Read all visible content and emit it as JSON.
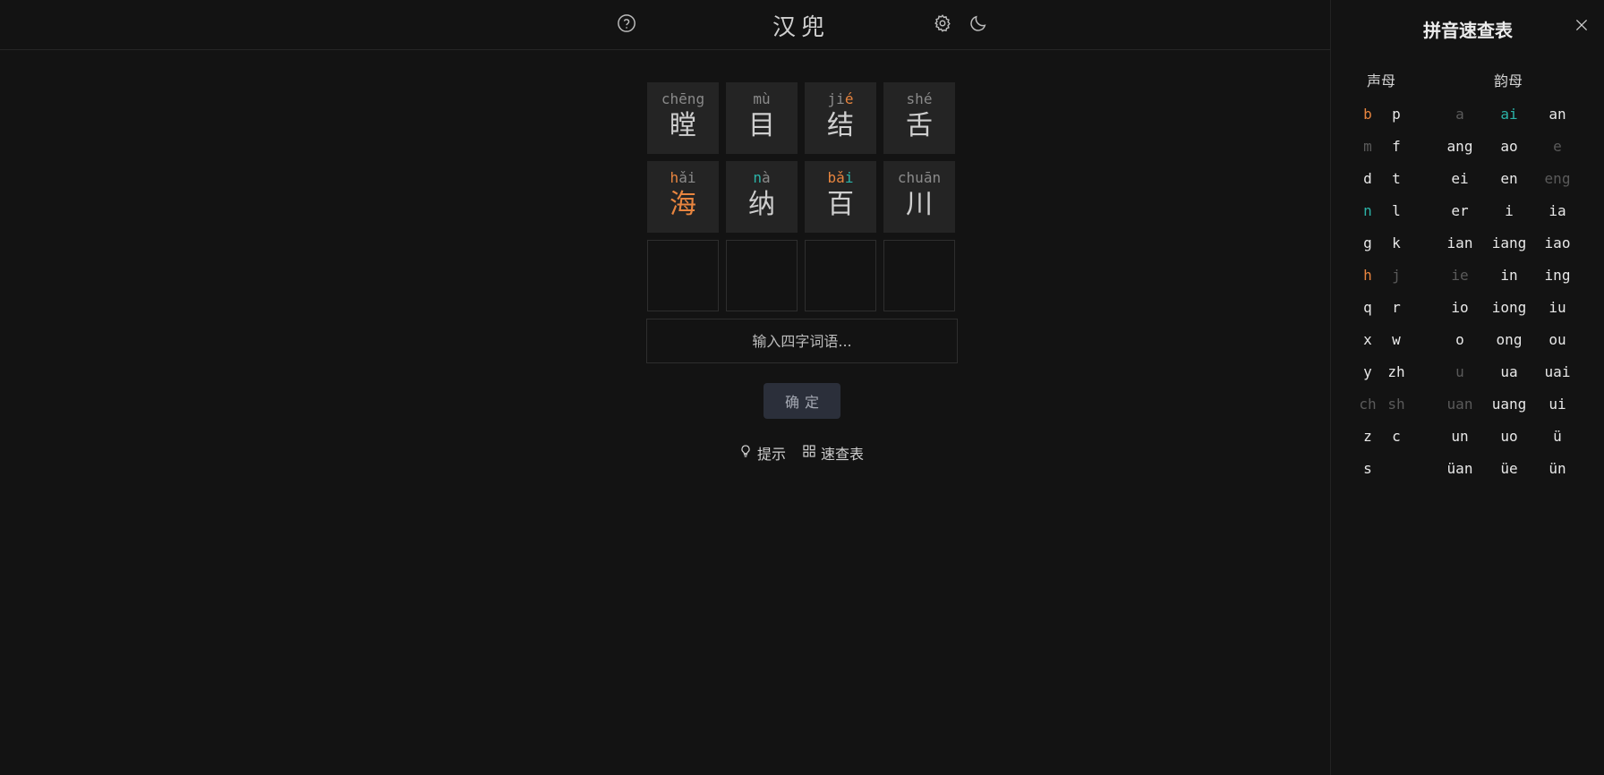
{
  "app": {
    "title": "汉兜"
  },
  "header": {
    "help_icon": "question-circle-icon",
    "settings_icon": "gear-icon",
    "theme_icon": "moon-icon"
  },
  "board": {
    "rows": [
      [
        {
          "pinyin": [
            {
              "t": "ch",
              "s": "dim"
            },
            {
              "t": "ēng",
              "s": "dim"
            }
          ],
          "hanzi": "瞠",
          "hanzi_state": "default"
        },
        {
          "pinyin": [
            {
              "t": "m",
              "s": "dim"
            },
            {
              "t": "ù",
              "s": "dim"
            }
          ],
          "hanzi": "目",
          "hanzi_state": "default"
        },
        {
          "pinyin": [
            {
              "t": "j",
              "s": "dim"
            },
            {
              "t": "i",
              "s": "dim"
            },
            {
              "t": "é",
              "s": "orange"
            }
          ],
          "hanzi": "结",
          "hanzi_state": "default"
        },
        {
          "pinyin": [
            {
              "t": "sh",
              "s": "dim"
            },
            {
              "t": "é",
              "s": "dim"
            }
          ],
          "hanzi": "舌",
          "hanzi_state": "default"
        }
      ],
      [
        {
          "pinyin": [
            {
              "t": "h",
              "s": "orange"
            },
            {
              "t": "ǎi",
              "s": "dim"
            }
          ],
          "hanzi": "海",
          "hanzi_state": "orange"
        },
        {
          "pinyin": [
            {
              "t": "n",
              "s": "teal"
            },
            {
              "t": "à",
              "s": "dim"
            }
          ],
          "hanzi": "纳",
          "hanzi_state": "default"
        },
        {
          "pinyin": [
            {
              "t": "b",
              "s": "orange"
            },
            {
              "t": "ǎ",
              "s": "orange"
            },
            {
              "t": "i",
              "s": "teal"
            }
          ],
          "hanzi": "百",
          "hanzi_state": "default"
        },
        {
          "pinyin": [
            {
              "t": "ch",
              "s": "dim"
            },
            {
              "t": "u",
              "s": "dim"
            },
            {
              "t": "ān",
              "s": "dim"
            }
          ],
          "hanzi": "川",
          "hanzi_state": "default"
        }
      ],
      [
        {
          "pinyin": [],
          "hanzi": "",
          "hanzi_state": "empty"
        },
        {
          "pinyin": [],
          "hanzi": "",
          "hanzi_state": "empty"
        },
        {
          "pinyin": [],
          "hanzi": "",
          "hanzi_state": "empty"
        },
        {
          "pinyin": [],
          "hanzi": "",
          "hanzi_state": "empty"
        }
      ]
    ]
  },
  "input": {
    "placeholder": "输入四字词语...",
    "value": ""
  },
  "confirm": {
    "label": "确定"
  },
  "actions": {
    "hint_label": "提示",
    "hint_icon": "lightbulb-icon",
    "table_label": "速查表",
    "table_icon": "grid-icon"
  },
  "sidebar": {
    "title": "拼音速查表",
    "close_icon": "close-icon",
    "initials_header": "声母",
    "finals_header": "韵母",
    "initials": [
      [
        {
          "t": "b",
          "s": "orange"
        },
        {
          "t": "p",
          "s": "normal"
        }
      ],
      [
        {
          "t": "m",
          "s": "absent"
        },
        {
          "t": "f",
          "s": "normal"
        }
      ],
      [
        {
          "t": "d",
          "s": "normal"
        },
        {
          "t": "t",
          "s": "normal"
        }
      ],
      [
        {
          "t": "n",
          "s": "teal"
        },
        {
          "t": "l",
          "s": "normal"
        }
      ],
      [
        {
          "t": "g",
          "s": "normal"
        },
        {
          "t": "k",
          "s": "normal"
        }
      ],
      [
        {
          "t": "h",
          "s": "orange"
        },
        {
          "t": "j",
          "s": "absent"
        }
      ],
      [
        {
          "t": "q",
          "s": "normal"
        },
        {
          "t": "r",
          "s": "normal"
        }
      ],
      [
        {
          "t": "x",
          "s": "normal"
        },
        {
          "t": "w",
          "s": "normal"
        }
      ],
      [
        {
          "t": "y",
          "s": "normal"
        },
        {
          "t": "zh",
          "s": "normal"
        }
      ],
      [
        {
          "t": "ch",
          "s": "absent"
        },
        {
          "t": "sh",
          "s": "absent"
        }
      ],
      [
        {
          "t": "z",
          "s": "normal"
        },
        {
          "t": "c",
          "s": "normal"
        }
      ],
      [
        {
          "t": "s",
          "s": "normal"
        }
      ]
    ],
    "finals": [
      [
        {
          "t": "a",
          "s": "absent"
        },
        {
          "t": "ai",
          "s": "teal"
        },
        {
          "t": "an",
          "s": "normal"
        }
      ],
      [
        {
          "t": "ang",
          "s": "normal"
        },
        {
          "t": "ao",
          "s": "normal"
        },
        {
          "t": "e",
          "s": "absent"
        }
      ],
      [
        {
          "t": "ei",
          "s": "normal"
        },
        {
          "t": "en",
          "s": "normal"
        },
        {
          "t": "eng",
          "s": "absent"
        }
      ],
      [
        {
          "t": "er",
          "s": "normal"
        },
        {
          "t": "i",
          "s": "normal"
        },
        {
          "t": "ia",
          "s": "normal"
        }
      ],
      [
        {
          "t": "ian",
          "s": "normal"
        },
        {
          "t": "iang",
          "s": "normal"
        },
        {
          "t": "iao",
          "s": "normal"
        }
      ],
      [
        {
          "t": "ie",
          "s": "absent"
        },
        {
          "t": "in",
          "s": "normal"
        },
        {
          "t": "ing",
          "s": "normal"
        }
      ],
      [
        {
          "t": "io",
          "s": "normal"
        },
        {
          "t": "iong",
          "s": "normal"
        },
        {
          "t": "iu",
          "s": "normal"
        }
      ],
      [
        {
          "t": "o",
          "s": "normal"
        },
        {
          "t": "ong",
          "s": "normal"
        },
        {
          "t": "ou",
          "s": "normal"
        }
      ],
      [
        {
          "t": "u",
          "s": "absent"
        },
        {
          "t": "ua",
          "s": "normal"
        },
        {
          "t": "uai",
          "s": "normal"
        }
      ],
      [
        {
          "t": "uan",
          "s": "absent"
        },
        {
          "t": "uang",
          "s": "normal"
        },
        {
          "t": "ui",
          "s": "normal"
        }
      ],
      [
        {
          "t": "un",
          "s": "normal"
        },
        {
          "t": "uo",
          "s": "normal"
        },
        {
          "t": "ü",
          "s": "normal"
        }
      ],
      [
        {
          "t": "üan",
          "s": "normal"
        },
        {
          "t": "üe",
          "s": "normal"
        },
        {
          "t": "ün",
          "s": "normal"
        }
      ]
    ]
  },
  "colors": {
    "present_wrong_position": "#e8853f",
    "correct": "#2bb3a8",
    "absent": "#5a5a5a",
    "background": "#131313",
    "tile": "#242424"
  }
}
